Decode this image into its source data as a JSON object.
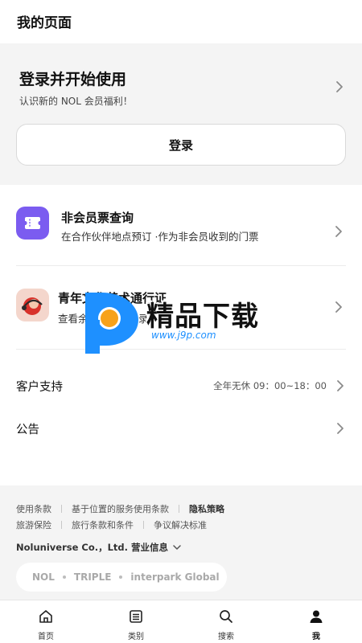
{
  "header": {
    "title": "我的页面"
  },
  "login": {
    "headline": "登录并开始使用",
    "subtitle": "认识新的 NOL 会员福利！",
    "button_label": "登录"
  },
  "menu": [
    {
      "title": "非会员票查询",
      "subtitle": "在合作伙伴地点预订 ·作为非会员收到的门票",
      "icon": "ticket-icon",
      "icon_color": "#7b5cf0"
    },
    {
      "title": "青年文化艺术通行证",
      "subtitle": "查看余额及使用记录",
      "icon": "youth-pass-icon",
      "icon_color": "#f4d6cc"
    }
  ],
  "support": {
    "label": "客户支持",
    "hours": "全年无休 09：00~18：00"
  },
  "notice": {
    "label": "公告"
  },
  "footer": {
    "links_row1": [
      "使用条款",
      "基于位置的服务使用条款",
      "隐私策略"
    ],
    "links_row2": [
      "旅游保险",
      "旅行条款和条件",
      "争议解决标准"
    ],
    "company": "Noluniverse Co.，Ltd.",
    "business_info": "营业信息",
    "brands": [
      "NOL",
      "TRIPLE",
      "interpark Global"
    ]
  },
  "watermark": {
    "text": "精品下载",
    "url": "www.j9p.com"
  },
  "tabs": [
    {
      "label": "首页",
      "icon": "home-icon",
      "active": false
    },
    {
      "label": "类别",
      "icon": "list-icon",
      "active": false
    },
    {
      "label": "搜索",
      "icon": "search-icon",
      "active": false
    },
    {
      "label": "我",
      "icon": "user-icon",
      "active": true
    }
  ],
  "colors": {
    "accent": "#7b5cf0",
    "section_bg": "#f4f4f4",
    "watermark_blue": "#1e90ff",
    "watermark_orange": "#f7a21b"
  }
}
